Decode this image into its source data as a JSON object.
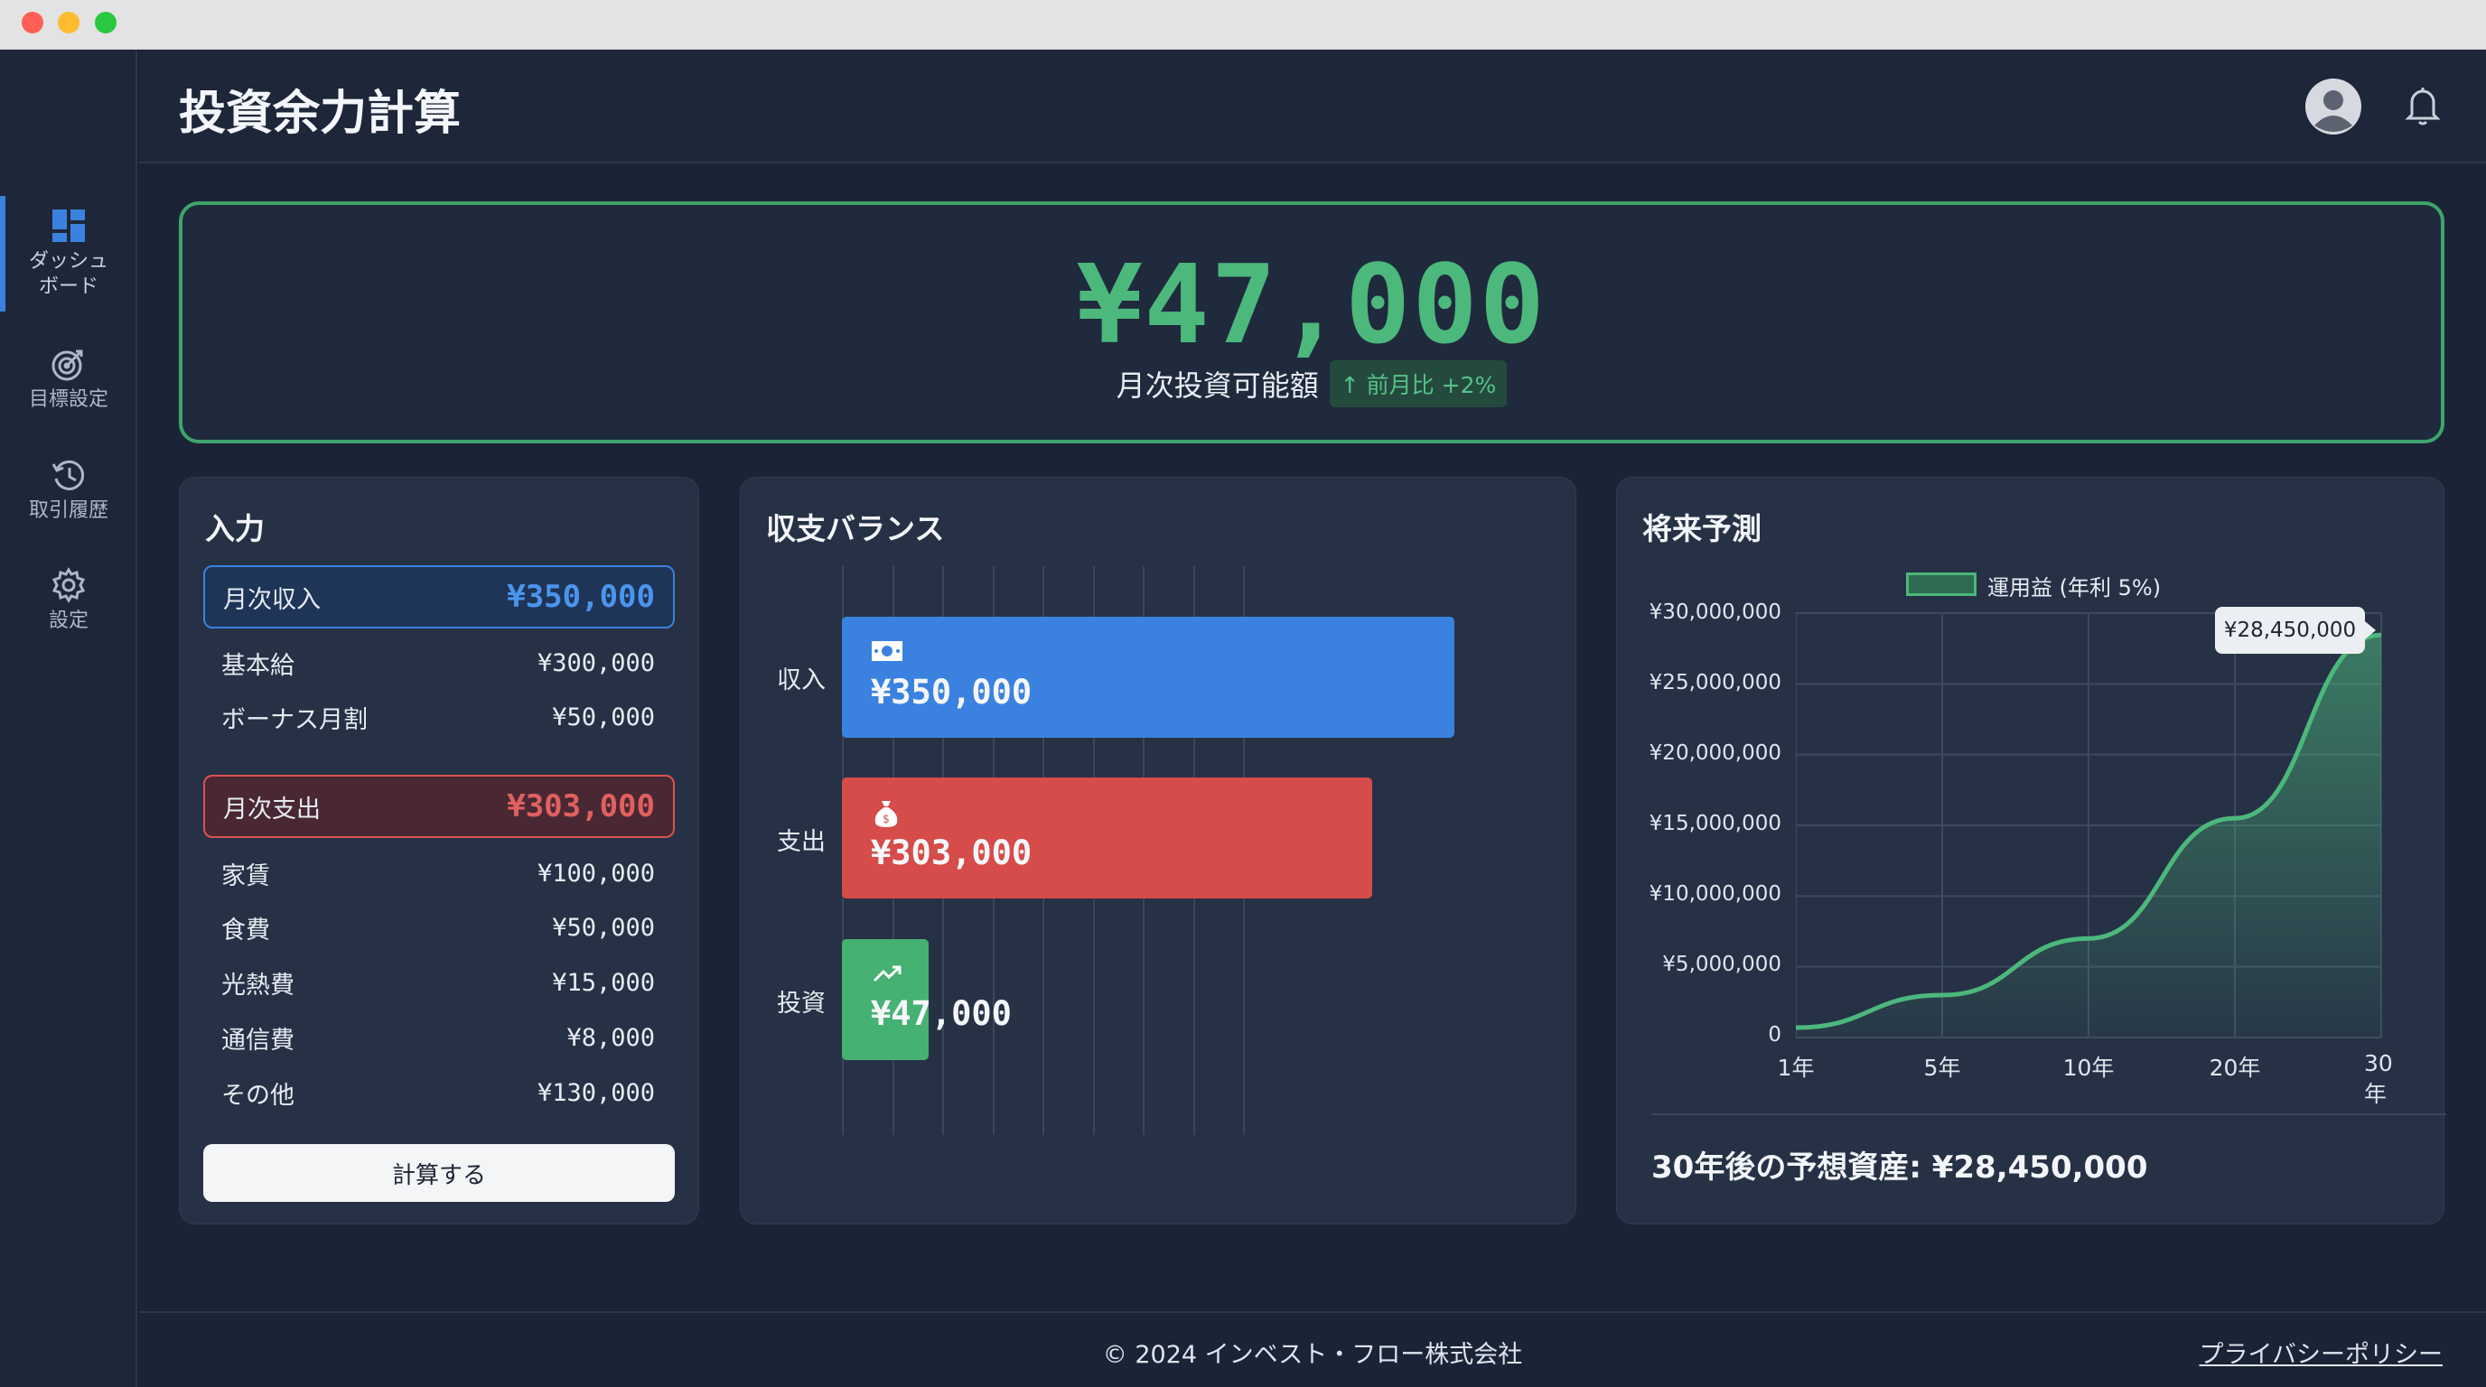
{
  "app": {
    "title": "投資余力計算"
  },
  "sidebar": {
    "items": [
      {
        "label": "ダッシュ\nボード",
        "icon": "dashboard-icon",
        "active": true
      },
      {
        "label": "目標設定",
        "icon": "target-icon"
      },
      {
        "label": "取引履歴",
        "icon": "history-icon"
      },
      {
        "label": "設定",
        "icon": "gear-icon"
      }
    ]
  },
  "hero": {
    "amount": "¥47,000",
    "label": "月次投資可能額",
    "change": "↑ 前月比 +2%"
  },
  "input": {
    "title": "入力",
    "income": {
      "label": "月次収入",
      "value": "¥350,000",
      "items": [
        {
          "label": "基本給",
          "value": "¥300,000"
        },
        {
          "label": "ボーナス月割",
          "value": "¥50,000"
        }
      ]
    },
    "expense": {
      "label": "月次支出",
      "value": "¥303,000",
      "items": [
        {
          "label": "家賃",
          "value": "¥100,000"
        },
        {
          "label": "食費",
          "value": "¥50,000"
        },
        {
          "label": "光熱費",
          "value": "¥15,000"
        },
        {
          "label": "通信費",
          "value": "¥8,000"
        },
        {
          "label": "その他",
          "value": "¥130,000"
        }
      ]
    },
    "calc_button": "計算する"
  },
  "balance": {
    "title": "収支バランス",
    "rows": [
      {
        "label": "収入",
        "value": "¥350,000",
        "amount": 350000,
        "color": "#3b82e0",
        "icon": "cash-icon"
      },
      {
        "label": "支出",
        "value": "¥303,000",
        "amount": 303000,
        "color": "#d64c4a",
        "icon": "money-bag-icon"
      },
      {
        "label": "投資",
        "value": "¥47,000",
        "amount": 47000,
        "color": "#45b172",
        "icon": "trend-up-icon"
      }
    ]
  },
  "projection": {
    "title": "将来予測",
    "legend": "運用益 (年利 5%)",
    "y_ticks": [
      "¥30,000,000",
      "¥25,000,000",
      "¥20,000,000",
      "¥15,000,000",
      "¥10,000,000",
      "¥5,000,000",
      "0"
    ],
    "x_ticks": [
      "1年",
      "5年",
      "10年",
      "20年",
      "30年"
    ],
    "tooltip": "¥28,450,000",
    "summary": "30年後の予想資産: ¥28,450,000"
  },
  "chart_data": {
    "type": "area",
    "title": "",
    "xlabel": "",
    "ylabel": "",
    "x": [
      "1年",
      "5年",
      "10年",
      "20年",
      "30年"
    ],
    "ylim": [
      0,
      30000000
    ],
    "series": [
      {
        "name": "運用益 (年利 5%)",
        "values": [
          700000,
          3000000,
          7000000,
          15500000,
          28450000
        ]
      }
    ],
    "grid": true,
    "legend": "top"
  },
  "footer": {
    "copyright": "© 2024 インベスト・フロー株式会社",
    "privacy": "プライバシーポリシー"
  },
  "colors": {
    "accent": "#3b82e0",
    "positive": "#4cb87c",
    "negative": "#d64c4a"
  }
}
